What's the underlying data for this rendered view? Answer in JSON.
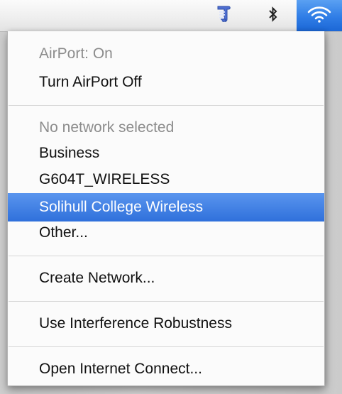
{
  "menubar": {
    "icons": {
      "script": "script-menu-icon",
      "bluetooth": "bluetooth-icon",
      "airport": "wifi-icon"
    },
    "colors": {
      "airport_highlight": "#2f7de6"
    }
  },
  "menu": {
    "status": "AirPort: On",
    "toggle": "Turn AirPort Off",
    "network_header": "No network selected",
    "networks": [
      "Business",
      "G604T_WIRELESS",
      "Solihull College Wireless",
      "Other..."
    ],
    "selected_network": "Solihull College Wireless",
    "create_network": "Create Network...",
    "interference": "Use Interference Robustness",
    "open_connect": "Open Internet Connect..."
  },
  "colors": {
    "selection": "#2f70db",
    "disabled_text": "#8c8c8c"
  }
}
